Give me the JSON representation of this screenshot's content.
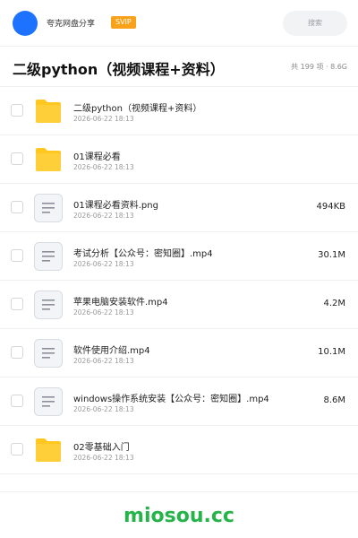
{
  "header": {
    "username": "夸克网盘分享",
    "vip_badge": "SVIP",
    "search_placeholder": "搜索",
    "avatar_color": "#1d73ff"
  },
  "folder": {
    "title": "二级python（视频课程+资料）",
    "summary": "共 199 项 · 8.6G"
  },
  "files": [
    {
      "type": "folder",
      "icon": "folder-icon",
      "name": "二级python（视频课程+资料）",
      "date": "2026-06-22 18:13",
      "size": ""
    },
    {
      "type": "folder",
      "icon": "folder-icon",
      "name": "01课程必看",
      "date": "2026-06-22 18:13",
      "size": ""
    },
    {
      "type": "file",
      "icon": "document-icon",
      "name": "01课程必看资料.png",
      "date": "2026-06-22 18:13",
      "size": "494KB"
    },
    {
      "type": "file",
      "icon": "document-icon",
      "name": "考试分析【公众号：密知圈】.mp4",
      "date": "2026-06-22 18:13",
      "size": "30.1M"
    },
    {
      "type": "file",
      "icon": "document-icon",
      "name": "苹果电脑安装软件.mp4",
      "date": "2026-06-22 18:13",
      "size": "4.2M"
    },
    {
      "type": "file",
      "icon": "document-icon",
      "name": "软件使用介绍.mp4",
      "date": "2026-06-22 18:13",
      "size": "10.1M"
    },
    {
      "type": "file",
      "icon": "document-icon",
      "name": "windows操作系统安装【公众号：密知圈】.mp4",
      "date": "2026-06-22 18:13",
      "size": "8.6M"
    },
    {
      "type": "folder",
      "icon": "folder-icon",
      "name": "02零基础入门",
      "date": "2026-06-22 18:13",
      "size": ""
    }
  ],
  "footer": {
    "watermark": "miosou.cc",
    "watermark_color": "#25b34a"
  },
  "colors": {
    "folder_yellow": "#ffc71f",
    "vip_orange": "#f7a21a"
  }
}
